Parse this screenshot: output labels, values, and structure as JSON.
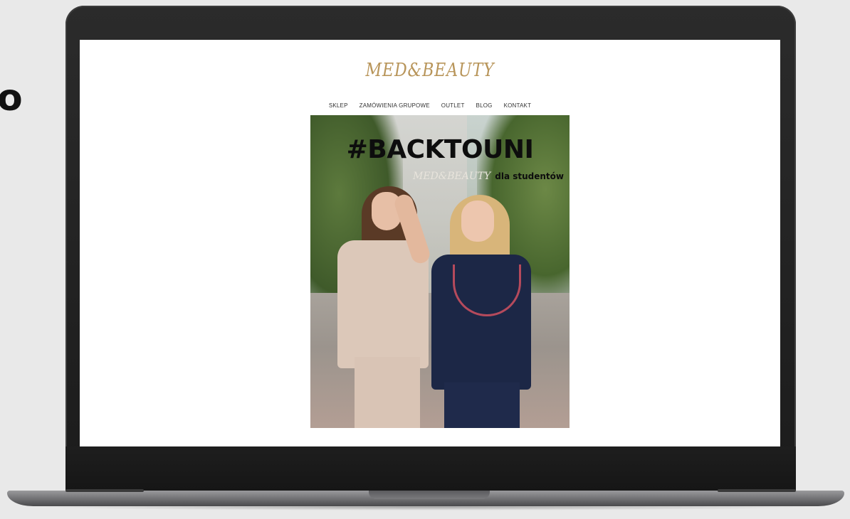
{
  "side_text": "o",
  "site": {
    "logo": "MED&BEAUTY",
    "nav": {
      "items": [
        "SKLEP",
        "ZAMÓWIENIA GRUPOWE",
        "OUTLET",
        "BLOG",
        "KONTAKT"
      ]
    },
    "hero": {
      "title": "#BACKTOUNI",
      "sub_logo": "MED&BEAUTY",
      "sub_text": "dla studentów"
    }
  },
  "colors": {
    "logo": "#b8955a",
    "hero_title": "#0d0d0d",
    "navy_scrub": "#1c2746",
    "beige_scrub": "#dcc8b9"
  }
}
